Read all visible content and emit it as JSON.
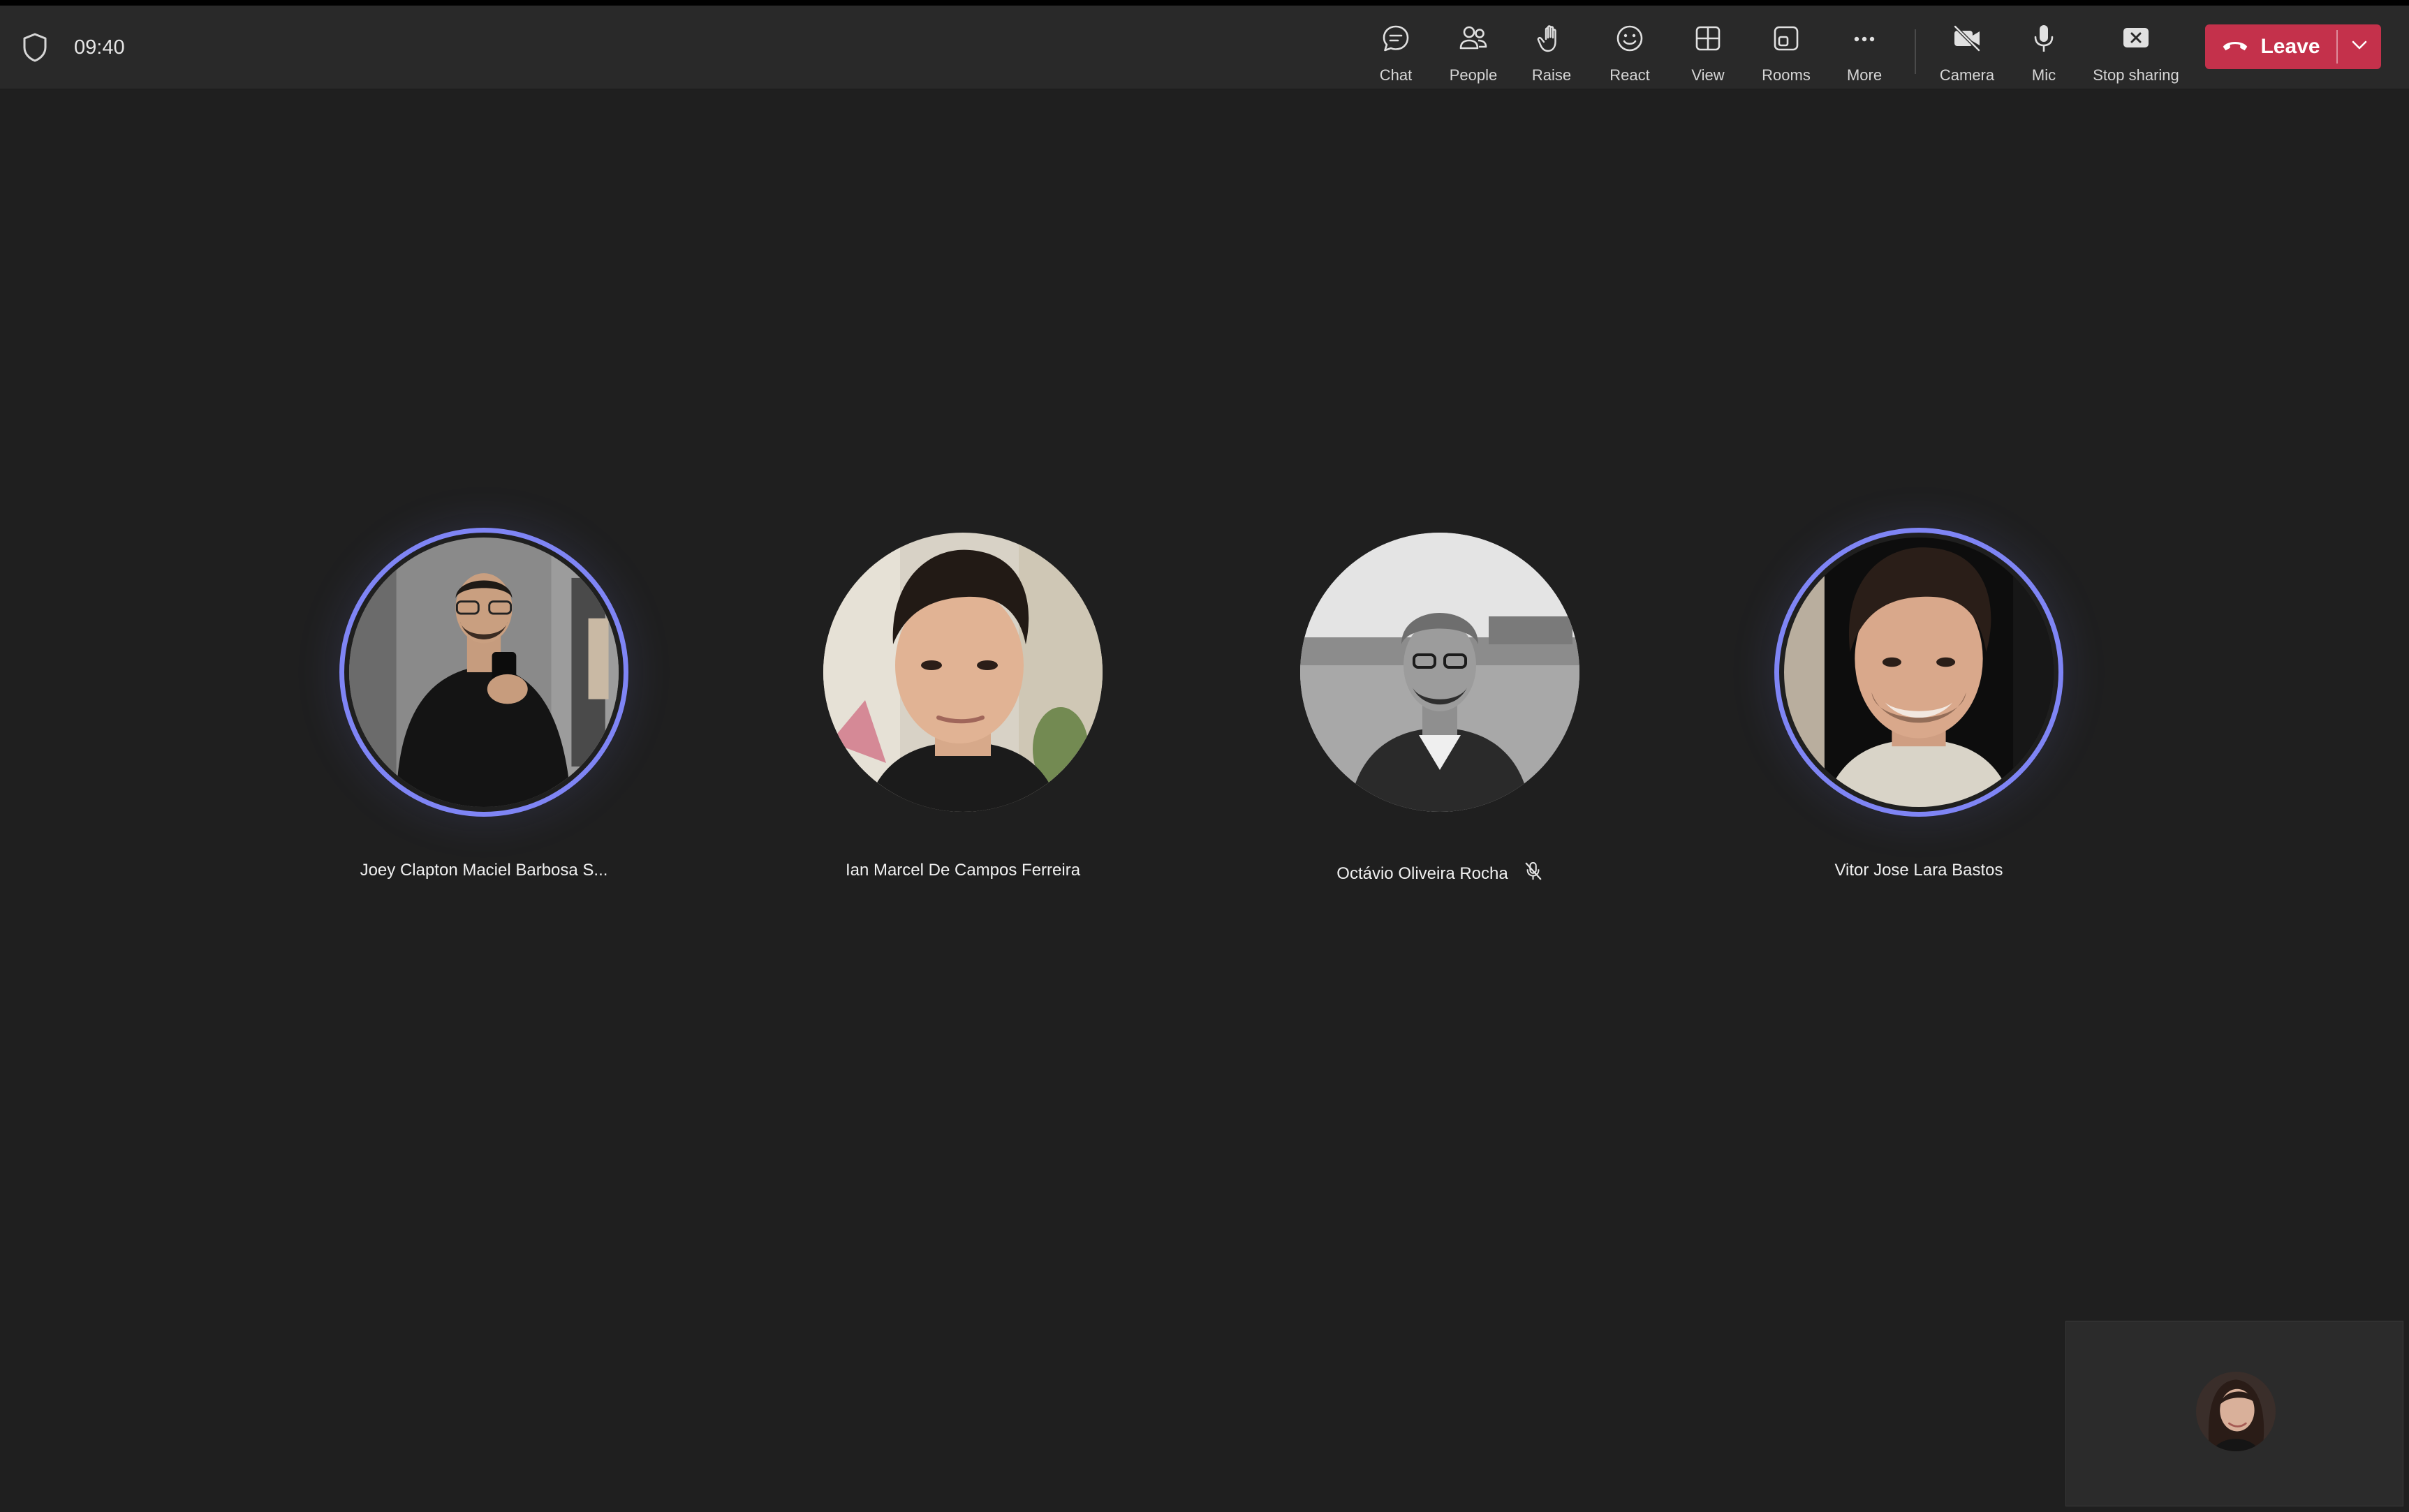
{
  "meeting": {
    "timer": "09:40"
  },
  "toolbar": {
    "items": [
      {
        "label": "Chat",
        "icon": "chat-icon"
      },
      {
        "label": "People",
        "icon": "people-icon"
      },
      {
        "label": "Raise",
        "icon": "raise-hand-icon"
      },
      {
        "label": "React",
        "icon": "react-emoji-icon"
      },
      {
        "label": "View",
        "icon": "view-grid-icon"
      },
      {
        "label": "Rooms",
        "icon": "rooms-icon"
      },
      {
        "label": "More",
        "icon": "more-ellipsis-icon"
      },
      {
        "label": "Camera",
        "icon": "camera-off-icon"
      },
      {
        "label": "Mic",
        "icon": "mic-icon"
      },
      {
        "label": "Stop sharing",
        "icon": "stop-sharing-icon"
      }
    ],
    "leave_label": "Leave"
  },
  "participants": [
    {
      "name": "Joey Clapton Maciel Barbosa S...",
      "speaking": true,
      "muted": false
    },
    {
      "name": "Ian Marcel De Campos Ferreira",
      "speaking": false,
      "muted": false
    },
    {
      "name": "Octávio Oliveira Rocha",
      "speaking": false,
      "muted": true
    },
    {
      "name": "Vitor Jose Lara Bastos",
      "speaking": true,
      "muted": false
    }
  ],
  "colors": {
    "background": "#1f1f1f",
    "toolbar": "#292929",
    "speaking_ring": "#7f85f5",
    "leave_button": "#c4314b"
  }
}
